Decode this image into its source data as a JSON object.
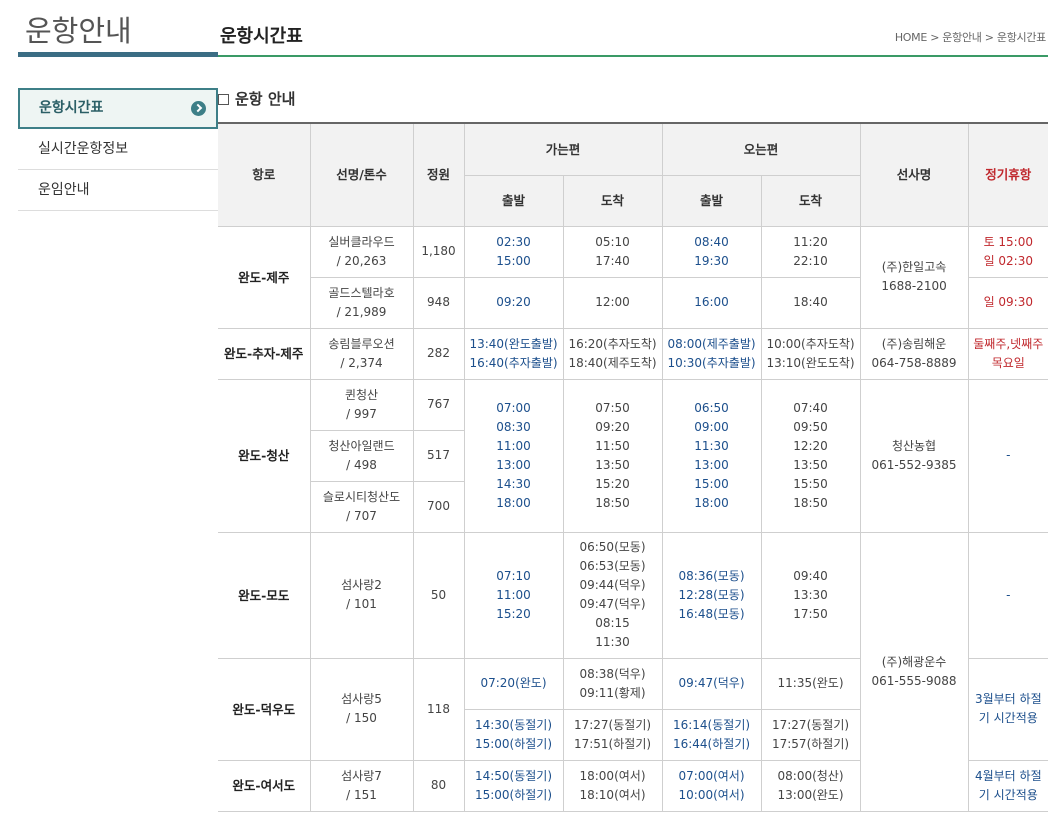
{
  "left_title": "운항안내",
  "page_title": "운항시간표",
  "breadcrumb": "HOME > 운항안내 > 운항시간표",
  "side_nav": [
    {
      "label": "운항시간표",
      "active": true
    },
    {
      "label": "실시간운항정보"
    },
    {
      "label": "운임안내"
    }
  ],
  "section_title": "운항 안내",
  "headers": {
    "route": "항로",
    "ship": "선명/톤수",
    "capacity": "정원",
    "outbound": "가는편",
    "inbound": "오는편",
    "depart": "출발",
    "arrive": "도착",
    "company": "선사명",
    "holiday": "정기휴항"
  },
  "routes": {
    "r1": {
      "name": "완도-제주"
    },
    "r2": {
      "name": "완도-추자-제주"
    },
    "r3": {
      "name": "완도-청산"
    },
    "r4": {
      "name": "완도-모도"
    },
    "r5": {
      "name": "완도-덕우도"
    },
    "r6": {
      "name": "완도-여서도"
    }
  },
  "ships": {
    "silver": {
      "name": "실버클라우드",
      "tonnage": "/ 20,263",
      "capacity": "1,180"
    },
    "gold": {
      "name": "골드스텔라호",
      "tonnage": "/ 21,989",
      "capacity": "948"
    },
    "songnim": {
      "name": "송림블루오션",
      "tonnage": "/ 2,374",
      "capacity": "282"
    },
    "queen": {
      "name": "퀸청산",
      "tonnage": "/ 997",
      "capacity": "767"
    },
    "island": {
      "name": "청산아일랜드",
      "tonnage": "/ 498",
      "capacity": "517"
    },
    "slow": {
      "name": "슬로시티청산도",
      "tonnage": "/ 707",
      "capacity": "700"
    },
    "seom2": {
      "name": "섬사랑2",
      "tonnage": "/ 101",
      "capacity": "50"
    },
    "seom5": {
      "name": "섬사랑5",
      "tonnage": "/ 150",
      "capacity": "118"
    },
    "seom7": {
      "name": "섬사랑7",
      "tonnage": "/ 151",
      "capacity": "80"
    }
  },
  "times": {
    "silver_out_dep": [
      "02:30",
      "15:00"
    ],
    "silver_out_arr": [
      "05:10",
      "17:40"
    ],
    "silver_in_dep": [
      "08:40",
      "19:30"
    ],
    "silver_in_arr": [
      "11:20",
      "22:10"
    ],
    "gold_out_dep": [
      "09:20"
    ],
    "gold_out_arr": [
      "12:00"
    ],
    "gold_in_dep": [
      "16:00"
    ],
    "gold_in_arr": [
      "18:40"
    ],
    "songnim_out_dep": [
      "13:40(완도출발)",
      "16:40(추자출발)"
    ],
    "songnim_out_arr": [
      "16:20(추자도착)",
      "18:40(제주도착)"
    ],
    "songnim_in_dep": [
      "08:00(제주출발)",
      "10:30(추자출발)"
    ],
    "songnim_in_arr": [
      "10:00(추자도착)",
      "13:10(완도도착)"
    ],
    "cheongsan_out_dep": [
      "07:00",
      "08:30",
      "11:00",
      "13:00",
      "14:30",
      "18:00"
    ],
    "cheongsan_out_arr": [
      "07:50",
      "09:20",
      "11:50",
      "13:50",
      "15:20",
      "18:50"
    ],
    "cheongsan_in_dep": [
      "06:50",
      "09:00",
      "11:30",
      "13:00",
      "15:00",
      "18:00"
    ],
    "cheongsan_in_arr": [
      "07:40",
      "09:50",
      "12:20",
      "13:50",
      "15:50",
      "18:50"
    ],
    "modo_out_dep": [
      "07:10",
      "11:00",
      "15:20"
    ],
    "modo_out_arr": [
      "06:50(모동)",
      "06:53(모동)",
      "09:44(덕우)",
      "09:47(덕우)",
      "08:15",
      "11:30"
    ],
    "modo_in_dep": [
      "08:36(모동)",
      "12:28(모동)",
      "16:48(모동)"
    ],
    "modo_in_arr": [
      "09:40",
      "13:30",
      "17:50"
    ],
    "deokwoo1_out_dep": [
      "07:20(완도)"
    ],
    "deokwoo1_out_arr": [
      "08:38(덕우)",
      "09:11(황제)"
    ],
    "deokwoo1_in_dep": [
      "09:47(덕우)"
    ],
    "deokwoo1_in_arr": [
      "11:35(완도)"
    ],
    "deokwoo2_out_dep": [
      "14:30(동절기)",
      "15:00(하절기)"
    ],
    "deokwoo2_out_arr": [
      "17:27(동절기)",
      "17:51(하절기)"
    ],
    "deokwoo2_in_dep": [
      "16:14(동절기)",
      "16:44(하절기)"
    ],
    "deokwoo2_in_arr": [
      "17:27(동절기)",
      "17:57(하절기)"
    ],
    "yeoseo_out_dep": [
      "14:50(동절기)",
      "15:00(하절기)"
    ],
    "yeoseo_out_arr": [
      "18:00(여서)",
      "18:10(여서)"
    ],
    "yeoseo_in_dep": [
      "07:00(여서)",
      "10:00(여서)"
    ],
    "yeoseo_in_arr": [
      "08:00(청산)",
      "13:00(완도)"
    ]
  },
  "companies": {
    "hanil": [
      "(주)한일고속",
      "1688-2100"
    ],
    "songnim": [
      "(주)송림해운",
      "064-758-8889"
    ],
    "cheongsan": [
      "청산농협",
      "061-552-9385"
    ],
    "haegwang": [
      "(주)해광운수",
      "061-555-9088"
    ]
  },
  "holidays": {
    "silver": [
      "토 15:00",
      "일 02:30"
    ],
    "gold": [
      "일 09:30"
    ],
    "songnim": [
      "둘째주,넷째주",
      "목요일"
    ],
    "cheongsan": [
      "-"
    ],
    "modo": [
      "-"
    ],
    "deokwoo": [
      "3월부터 하절",
      "기 시간적용"
    ],
    "yeoseo": [
      "4월부터 하절",
      "기 시간적용"
    ]
  },
  "colors": {
    "accent_teal": "#3d7f87",
    "title_line": "#3a9a66",
    "time_blue": "#1c4f8c",
    "holiday_red": "#c0282d"
  }
}
